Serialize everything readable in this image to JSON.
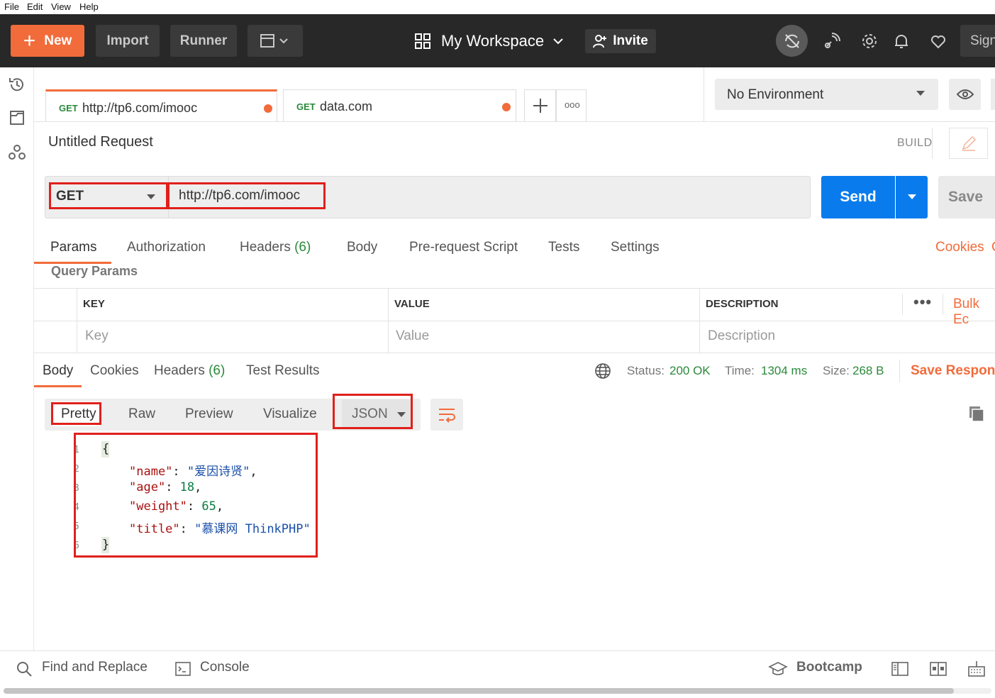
{
  "menu": [
    "File",
    "Edit",
    "View",
    "Help"
  ],
  "header": {
    "new_label": "New",
    "import_label": "Import",
    "runner_label": "Runner",
    "workspace_label": "My Workspace",
    "invite_label": "Invite",
    "signin_label": "Sign"
  },
  "tabs": [
    {
      "method": "GET",
      "url": "http://tp6.com/imooc"
    },
    {
      "method": "GET",
      "url": "data.com"
    }
  ],
  "tab_more": "ooo",
  "environment": {
    "selected": "No Environment"
  },
  "request": {
    "name": "Untitled Request",
    "build_label": "BUILD",
    "method": "GET",
    "url": "http://tp6.com/imooc",
    "send_label": "Send",
    "save_label": "Save"
  },
  "request_tabs": {
    "params": "Params",
    "authorization": "Authorization",
    "headers": "Headers",
    "headers_count": "(6)",
    "body": "Body",
    "prerequest": "Pre-request Script",
    "tests": "Tests",
    "settings": "Settings",
    "cookies": "Cookies",
    "code_cut": "C"
  },
  "query_params": {
    "title": "Query Params",
    "col_key": "KEY",
    "col_value": "VALUE",
    "col_description": "DESCRIPTION",
    "bulk_edit": "Bulk Ec",
    "key_placeholder": "Key",
    "value_placeholder": "Value",
    "description_placeholder": "Description"
  },
  "response": {
    "tabs": {
      "body": "Body",
      "cookies": "Cookies",
      "headers": "Headers",
      "headers_count": "(6)",
      "test_results": "Test Results"
    },
    "status_label": "Status:",
    "status_value": "200 OK",
    "time_label": "Time:",
    "time_value": "1304 ms",
    "size_label": "Size:",
    "size_value": "268 B",
    "save_response": "Save Respons",
    "view_modes": {
      "pretty": "Pretty",
      "raw": "Raw",
      "preview": "Preview",
      "visualize": "Visualize"
    },
    "format": "JSON",
    "json": {
      "line_numbers": [
        "1",
        "2",
        "3",
        "4",
        "5",
        "6"
      ],
      "open_brace": "{",
      "close_brace": "}",
      "name_key": "\"name\"",
      "name_value": "\"爱因诗贤\"",
      "age_key": "\"age\"",
      "age_value": "18",
      "weight_key": "\"weight\"",
      "weight_value": "65",
      "title_key": "\"title\"",
      "title_value": "\"慕课网 ThinkPHP\""
    }
  },
  "footer": {
    "find_replace": "Find and Replace",
    "console": "Console",
    "bootcamp": "Bootcamp"
  },
  "colors": {
    "accent": "#f26b3a",
    "send": "#097bed",
    "highlight": "#e0201c",
    "success": "#2a8a3a"
  }
}
